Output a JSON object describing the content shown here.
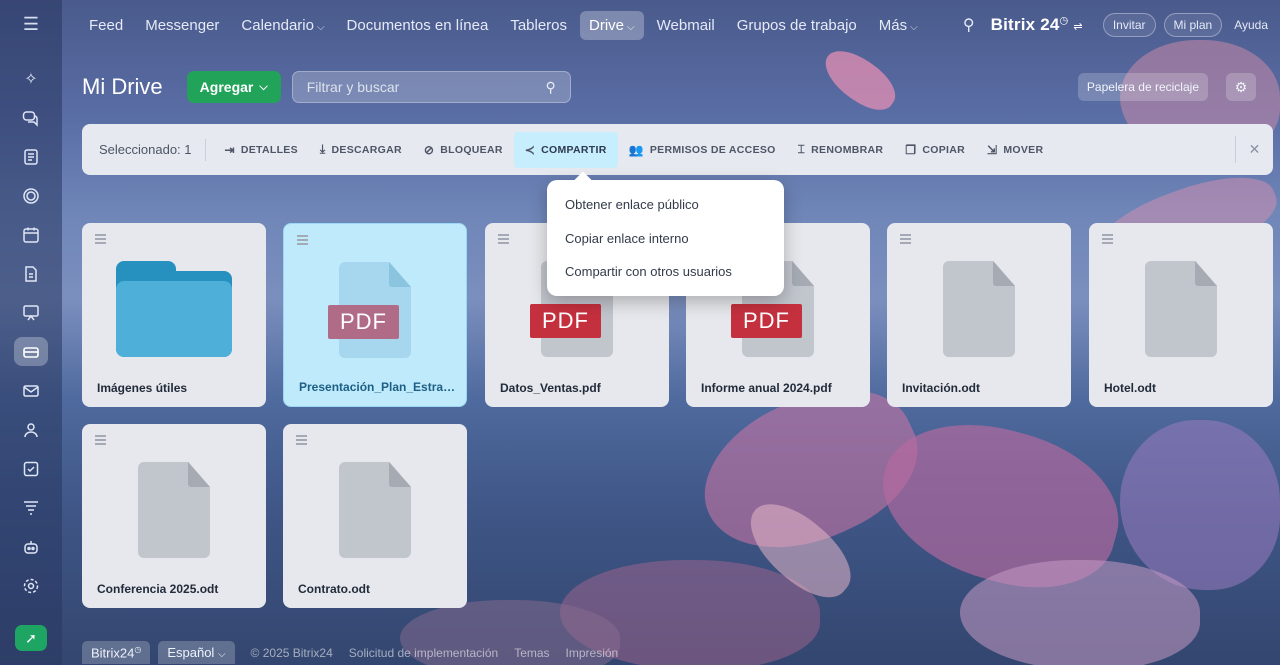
{
  "colors": {
    "accent_green": "#22a35a",
    "selected_card": "#bfeafc",
    "active_action": "#c6eefc",
    "pdf_red": "#c5303e",
    "folder_blue": "#4eafd9"
  },
  "topnav": {
    "items": [
      {
        "label": "Feed",
        "has_dropdown": false
      },
      {
        "label": "Messenger",
        "has_dropdown": false
      },
      {
        "label": "Calendario",
        "has_dropdown": true
      },
      {
        "label": "Documentos en línea",
        "has_dropdown": false
      },
      {
        "label": "Tableros",
        "has_dropdown": false
      },
      {
        "label": "Drive",
        "has_dropdown": true,
        "active": true
      },
      {
        "label": "Webmail",
        "has_dropdown": false
      },
      {
        "label": "Grupos de trabajo",
        "has_dropdown": false
      },
      {
        "label": "Más",
        "has_dropdown": true
      }
    ],
    "brand": "Bitrix 24",
    "invite": "Invitar",
    "my_plan": "Mi plan",
    "help": "Ayuda"
  },
  "header": {
    "title": "Mi Drive",
    "add_label": "Agregar",
    "search_placeholder": "Filtrar y buscar",
    "trash_label": "Papelera de reciclaje"
  },
  "actionbar": {
    "selected": "Seleccionado: 1",
    "actions": [
      {
        "label": "DETALLES",
        "icon": "enter-icon",
        "active": false
      },
      {
        "label": "DESCARGAR",
        "icon": "download-icon",
        "active": false
      },
      {
        "label": "BLOQUEAR",
        "icon": "block-icon",
        "active": false
      },
      {
        "label": "COMPARTIR",
        "icon": "share-icon",
        "active": true
      },
      {
        "label": "PERMISOS DE ACCESO",
        "icon": "users-icon",
        "active": false
      },
      {
        "label": "RENOMBRAR",
        "icon": "rename-icon",
        "active": false
      },
      {
        "label": "COPIAR",
        "icon": "copy-icon",
        "active": false
      },
      {
        "label": "MOVER",
        "icon": "move-icon",
        "active": false
      }
    ]
  },
  "share_menu": {
    "items": [
      "Obtener enlace público",
      "Copiar enlace interno",
      "Compartir con otros usuarios"
    ]
  },
  "files": [
    {
      "name": "Imágenes útiles",
      "kind": "folder",
      "selected": false
    },
    {
      "name": "Presentación_Plan_Estraté...",
      "kind": "pdf",
      "selected": true
    },
    {
      "name": "Datos_Ventas.pdf",
      "kind": "pdf",
      "selected": false
    },
    {
      "name": "Informe anual 2024.pdf",
      "kind": "pdf",
      "selected": false
    },
    {
      "name": "Invitación.odt",
      "kind": "doc",
      "selected": false
    },
    {
      "name": "Hotel.odt",
      "kind": "doc",
      "selected": false
    },
    {
      "name": "Conferencia 2025.odt",
      "kind": "doc",
      "selected": false
    },
    {
      "name": "Contrato.odt",
      "kind": "doc",
      "selected": false
    }
  ],
  "pdf_badge": "PDF",
  "footer": {
    "brand": "Bitrix24",
    "language": "Español",
    "copyright": "© 2025 Bitrix24",
    "links": [
      "Solicitud de implementación",
      "Temas",
      "Impresión"
    ]
  },
  "rail": {
    "apps": [
      "feed-icon",
      "chat-icon",
      "document-icon",
      "circle-icon",
      "calendar-icon",
      "file-icon",
      "presentation-icon",
      "drive-icon",
      "mail-icon",
      "contacts-icon",
      "tasks-icon",
      "filter-icon",
      "robot-icon",
      "settings-icon"
    ],
    "active": "drive-icon"
  }
}
